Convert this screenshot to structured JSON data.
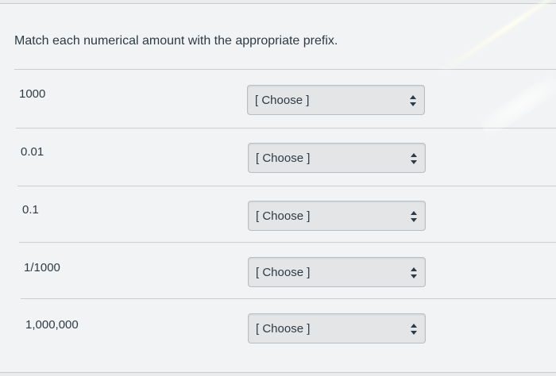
{
  "question": {
    "prompt": "Match each numerical amount with the appropriate prefix."
  },
  "answers": [
    {
      "label": "1000",
      "selected": "[ Choose ]"
    },
    {
      "label": "0.01",
      "selected": "[ Choose ]"
    },
    {
      "label": "0.1",
      "selected": "[ Choose ]"
    },
    {
      "label": "1/1000",
      "selected": "[ Choose ]"
    },
    {
      "label": "1,000,000",
      "selected": "[ Choose ]"
    }
  ],
  "icons": {
    "select_arrows": "up-down-arrows-icon"
  },
  "colors": {
    "background": "#f2f3f4",
    "text": "#2d3b45",
    "select_background": "#e3e5e7"
  }
}
